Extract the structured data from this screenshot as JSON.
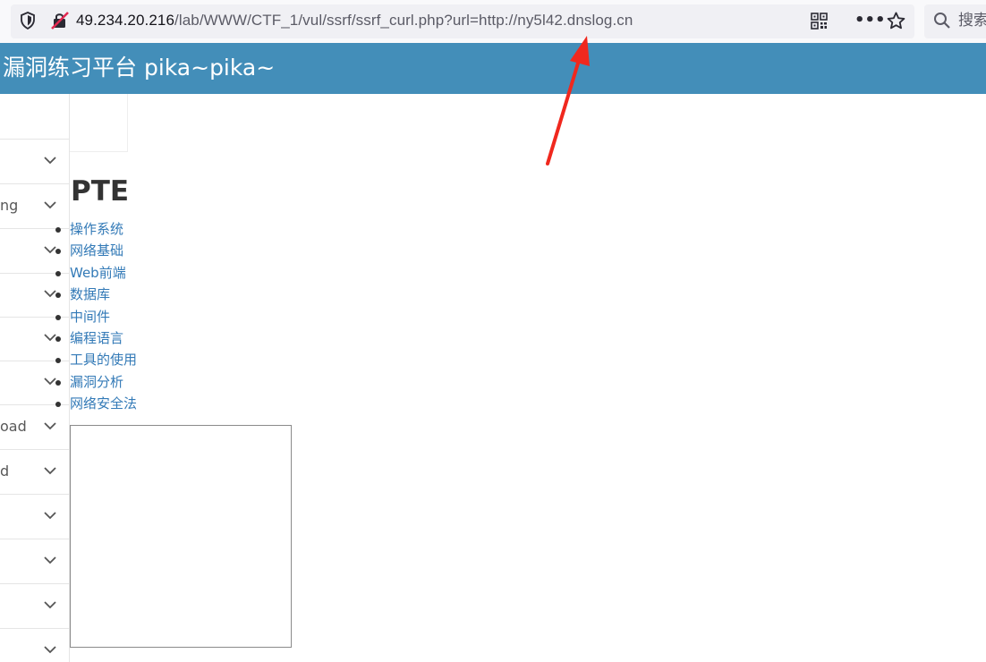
{
  "browser": {
    "url_host": "49.234.20.216",
    "url_path": "/lab/WWW/CTF_1/vul/ssrf/ssrf_curl.php?url=http://ny5l42.dnslog.cn",
    "search_placeholder": "搜索",
    "icons": [
      "shield-icon",
      "insecure-lock-icon",
      "qr-code-icon",
      "more-icon",
      "bookmark-star-icon",
      "search-icon"
    ]
  },
  "site": {
    "title": "漏洞练习平台 pika~pika~",
    "header_color": "#438eb9"
  },
  "sidebar": {
    "items": [
      {
        "label": ""
      },
      {
        "label": "ng"
      },
      {
        "label": ""
      },
      {
        "label": ""
      },
      {
        "label": ""
      },
      {
        "label": ""
      },
      {
        "label": "oad"
      },
      {
        "label": "d"
      },
      {
        "label": ""
      },
      {
        "label": ""
      },
      {
        "label": ""
      },
      {
        "label": ""
      }
    ]
  },
  "main": {
    "heading": "PTE",
    "topics": [
      "操作系统",
      "网络基础",
      "Web前端",
      "数据库",
      "中间件",
      "编程语言",
      "工具的使用",
      "漏洞分析",
      "网络安全法"
    ],
    "link_color": "#337ab7"
  },
  "annotation": {
    "arrow_color": "#f0281e"
  }
}
